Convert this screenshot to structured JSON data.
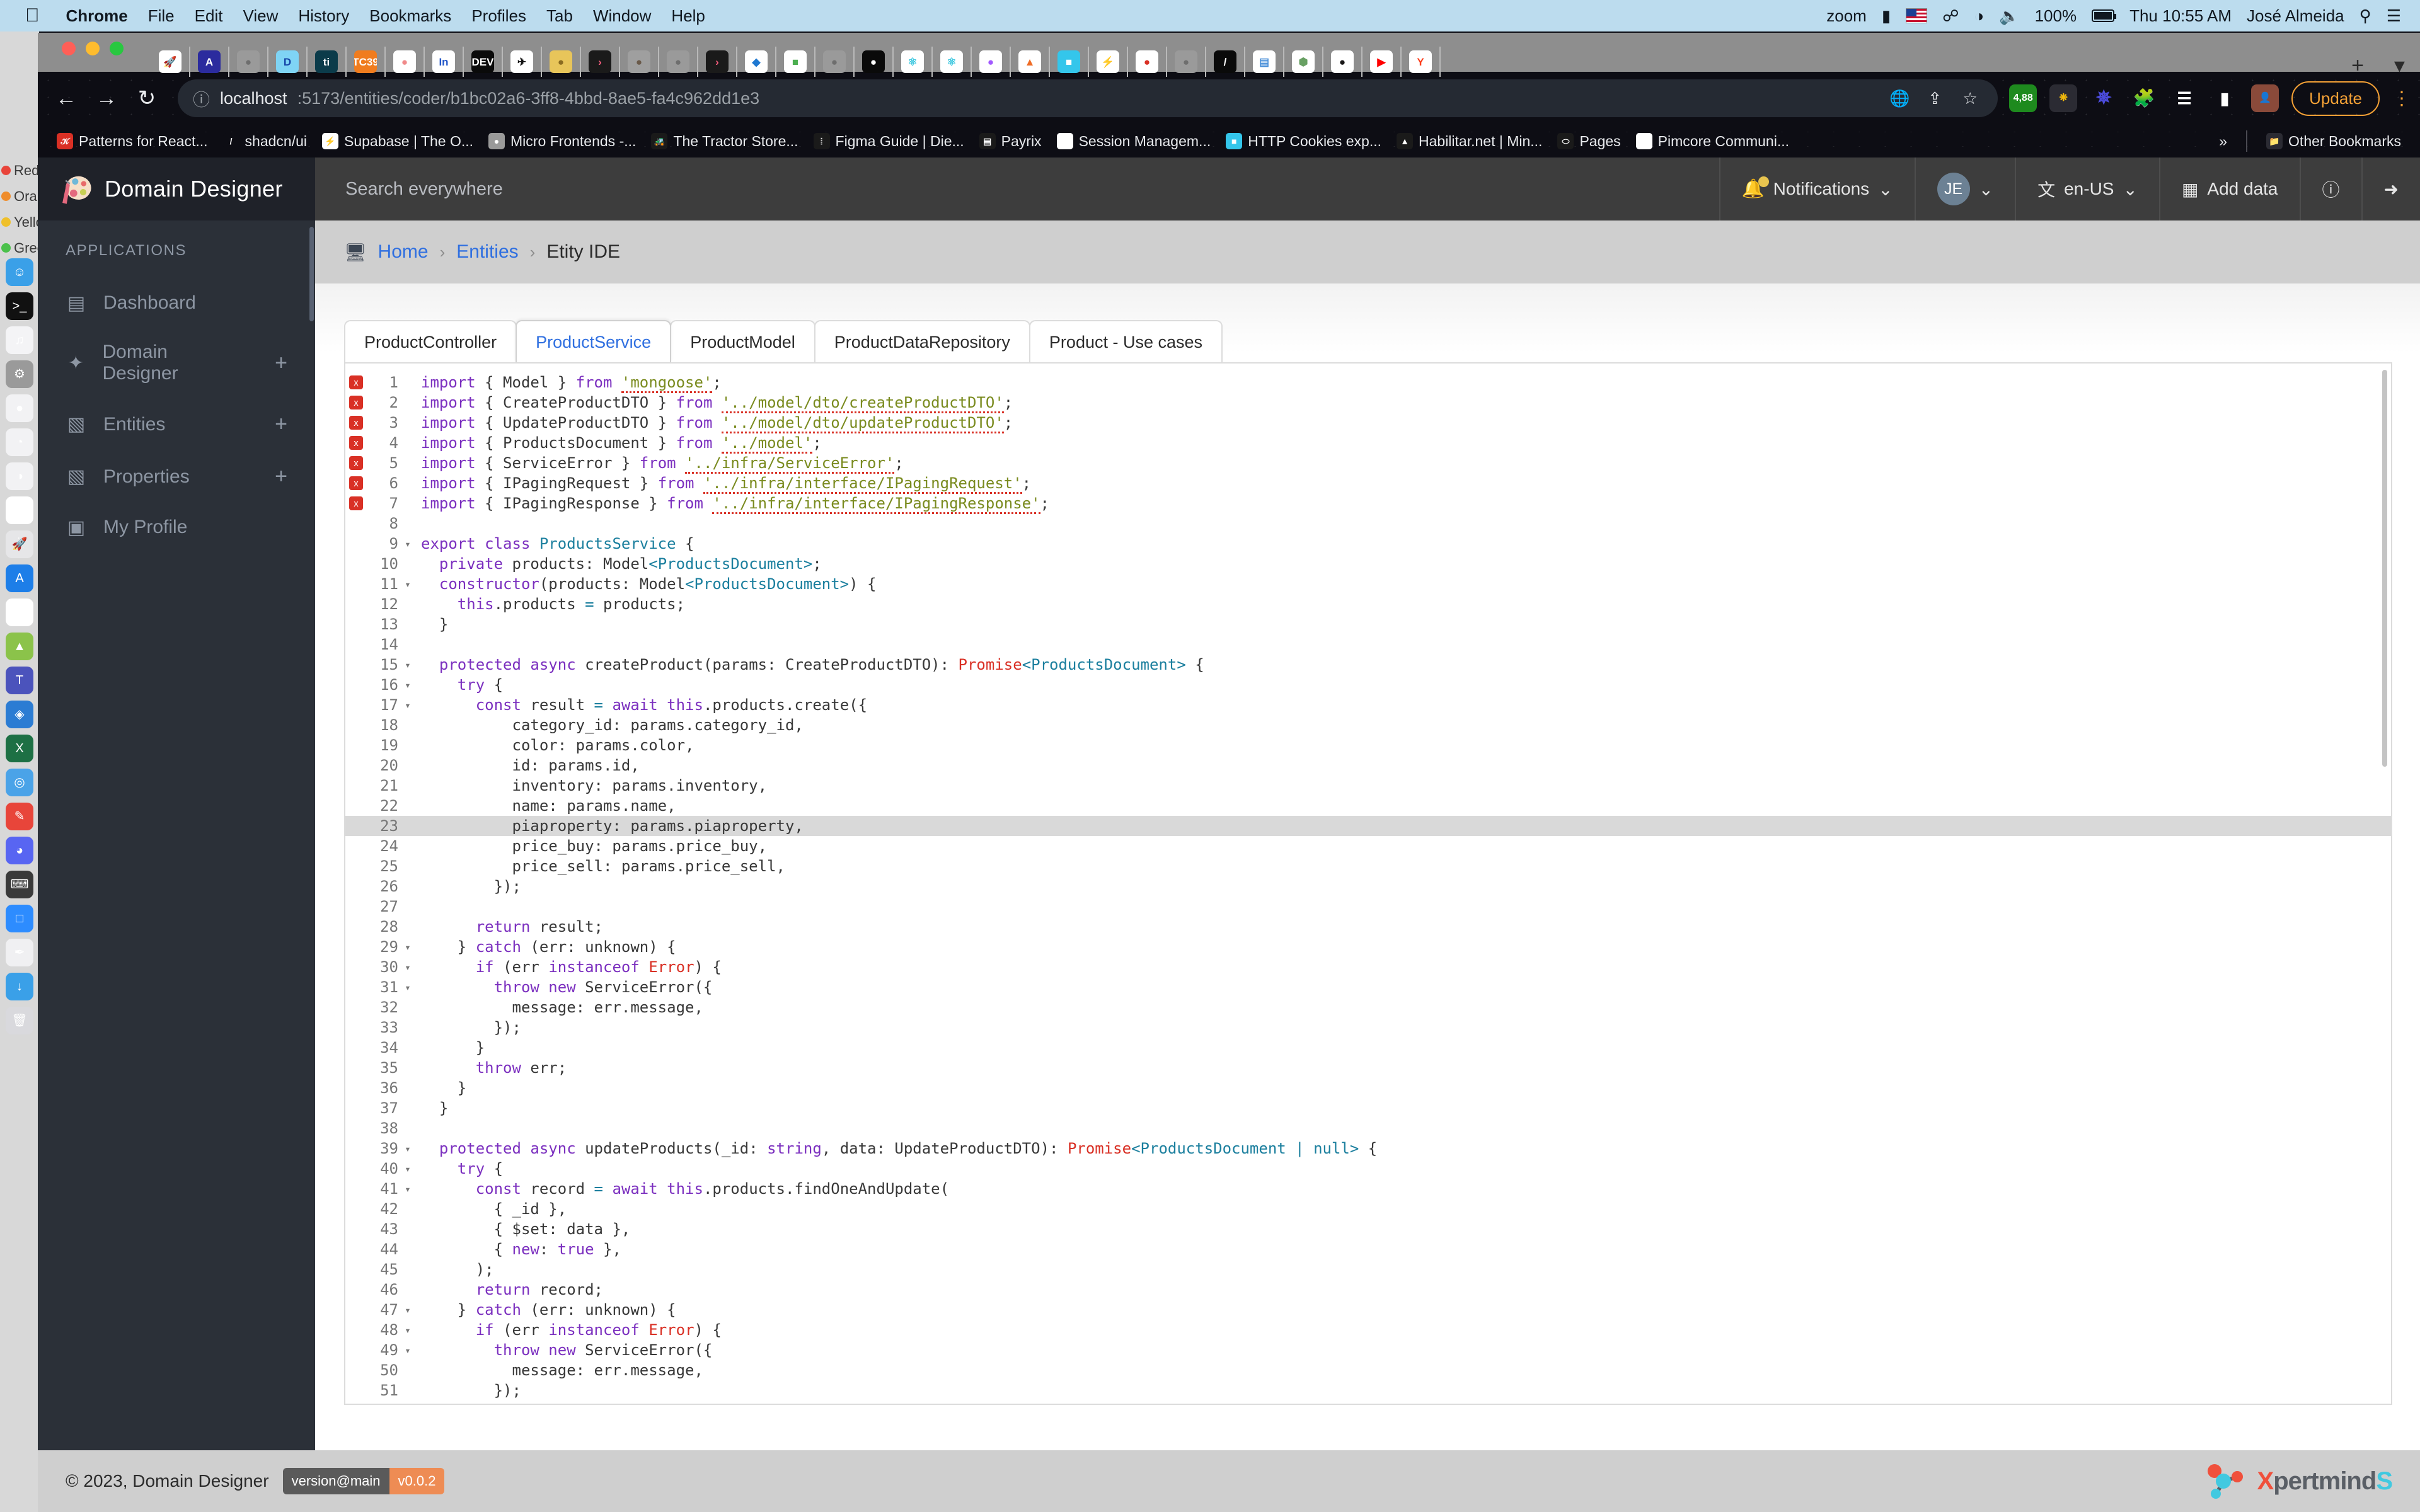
{
  "mac_menubar": {
    "apple": "",
    "items": [
      "Chrome",
      "File",
      "Edit",
      "View",
      "History",
      "Bookmarks",
      "Profiles",
      "Tab",
      "Window",
      "Help"
    ],
    "right": {
      "zoom": "zoom",
      "battery_percent": "100%",
      "clock": "Thu 10:55 AM",
      "user": "José Almeida"
    }
  },
  "browser": {
    "url_host": "localhost",
    "url_path": ":5173/entities/coder/b1bc02a6-3ff8-4bbd-8ae5-fa4c962dd1e3",
    "update_label": "Update",
    "extension_badge": "4,88",
    "tab_icons": [
      {
        "name": "rocket-tab-icon",
        "glyph": "🚀",
        "bg": "#ffffff",
        "color": "#ef8b32"
      },
      {
        "name": "algolia-tab-icon",
        "glyph": "A",
        "bg": "#2b2b9e",
        "color": "#ffffff"
      },
      {
        "name": "globe-tab-icon",
        "glyph": "●",
        "bg": "#9a9a9a",
        "color": "#6e6e6e"
      },
      {
        "name": "deno-tab-icon",
        "glyph": "D",
        "bg": "#7fd4f5",
        "color": "#1645a8"
      },
      {
        "name": "ti-tab-icon",
        "glyph": "ti",
        "bg": "#0b3b4a",
        "color": "#ffffff"
      },
      {
        "name": "tc39-tab-icon",
        "glyph": "TC39",
        "bg": "#f07c1e",
        "color": "#ffffff"
      },
      {
        "name": "nexus-tab-icon",
        "glyph": "●",
        "bg": "#ffffff",
        "color": "#f08a8a"
      },
      {
        "name": "insquad-tab-icon",
        "glyph": "In",
        "bg": "#ffffff",
        "color": "#2256c8"
      },
      {
        "name": "dev-tab-icon",
        "glyph": "DEV",
        "bg": "#0a0a0a",
        "color": "#ffffff"
      },
      {
        "name": "session-tab-icon",
        "glyph": "✈",
        "bg": "#ffffff",
        "color": "#111111"
      },
      {
        "name": "avatar-tab-icon",
        "glyph": "●",
        "bg": "#e8c55a",
        "color": "#8a6b20"
      },
      {
        "name": "chevron-tab-icon",
        "glyph": "›",
        "bg": "#1a1a1a",
        "color": "#f05a7a"
      },
      {
        "name": "photo-tab-icon",
        "glyph": "●",
        "bg": "#9f9f9f",
        "color": "#6a5a4a"
      },
      {
        "name": "globe2-tab-icon",
        "glyph": "●",
        "bg": "#9a9a9a",
        "color": "#6e6e6e"
      },
      {
        "name": "chevron2-tab-icon",
        "glyph": "›",
        "bg": "#1a1a1a",
        "color": "#f05a7a"
      },
      {
        "name": "diamond-tab-icon",
        "glyph": "◆",
        "bg": "#ffffff",
        "color": "#1f78d1"
      },
      {
        "name": "pimcore-tab-icon",
        "glyph": "■",
        "bg": "#ffffff",
        "color": "#4caf50"
      },
      {
        "name": "globe3-tab-icon",
        "glyph": "●",
        "bg": "#9a9a9a",
        "color": "#6e6e6e"
      },
      {
        "name": "medium-tab-icon",
        "glyph": "●",
        "bg": "#0a0a0a",
        "color": "#ffffff"
      },
      {
        "name": "react-tab-icon",
        "glyph": "⚛",
        "bg": "#ffffff",
        "color": "#3ec8e0"
      },
      {
        "name": "react2-tab-icon",
        "glyph": "⚛",
        "bg": "#ffffff",
        "color": "#3ec8e0"
      },
      {
        "name": "figma-tab-icon",
        "glyph": "●",
        "bg": "#ffffff",
        "color": "#a259ff"
      },
      {
        "name": "habilitar-tab-icon",
        "glyph": "▲",
        "bg": "#ffffff",
        "color": "#ef6c26"
      },
      {
        "name": "cookie-tab-icon",
        "glyph": "■",
        "bg": "#34c6eb",
        "color": "#ffffff"
      },
      {
        "name": "supabase-tab-icon",
        "glyph": "⚡",
        "bg": "#ffffff",
        "color": "#3ecf8e"
      },
      {
        "name": "tractor-tab-icon",
        "glyph": "●",
        "bg": "#ffffff",
        "color": "#d93025"
      },
      {
        "name": "micro-tab-icon",
        "glyph": "●",
        "bg": "#9a9a9a",
        "color": "#6e6e6e"
      },
      {
        "name": "shadcn-tab-icon",
        "glyph": "/",
        "bg": "#0a0a0a",
        "color": "#ffffff"
      },
      {
        "name": "db-tab-icon",
        "glyph": "▤",
        "bg": "#ffffff",
        "color": "#4a90d9"
      },
      {
        "name": "node-tab-icon",
        "glyph": "⬢",
        "bg": "#ffffff",
        "color": "#68a063"
      },
      {
        "name": "github-tab-icon",
        "glyph": "●",
        "bg": "#ffffff",
        "color": "#181717"
      },
      {
        "name": "youtube-tab-icon",
        "glyph": "▶",
        "bg": "#ffffff",
        "color": "#ff0000"
      },
      {
        "name": "yandex-tab-icon",
        "glyph": "Y",
        "bg": "#ffffff",
        "color": "#fc3f1d"
      }
    ],
    "bookmarks": [
      {
        "label": "Patterns for React...",
        "icon_name": "patterns-bookmark-icon",
        "glyph": "𝒦",
        "bg": "#d93025"
      },
      {
        "label": "shadcn/ui",
        "icon_name": "shadcn-bookmark-icon",
        "glyph": "/",
        "bg": "#0d0d14"
      },
      {
        "label": "Supabase | The O...",
        "icon_name": "supabase-bookmark-icon",
        "glyph": "⚡",
        "bg": "#ffffff"
      },
      {
        "label": "Micro Frontends -...",
        "icon_name": "microfrontends-bookmark-icon",
        "glyph": "●",
        "bg": "#9a9a9a"
      },
      {
        "label": "The Tractor Store...",
        "icon_name": "tractor-bookmark-icon",
        "glyph": "🚜",
        "bg": "#1a1a1a"
      },
      {
        "label": "Figma Guide | Die...",
        "icon_name": "figma-bookmark-icon",
        "glyph": "⦙",
        "bg": "#1a1a1a"
      },
      {
        "label": "Payrix",
        "icon_name": "payrix-bookmark-icon",
        "glyph": "▤",
        "bg": "#1a1a1a"
      },
      {
        "label": "Session Managem...",
        "icon_name": "session-bookmark-icon",
        "glyph": "✈",
        "bg": "#ffffff"
      },
      {
        "label": "HTTP Cookies exp...",
        "icon_name": "cookies-bookmark-icon",
        "glyph": "■",
        "bg": "#34c6eb"
      },
      {
        "label": "Habilitar.net | Min...",
        "icon_name": "habilitar-bookmark-icon",
        "glyph": "▲",
        "bg": "#1a1a1a"
      },
      {
        "label": "Pages",
        "icon_name": "pages-bookmark-icon",
        "glyph": "⬭",
        "bg": "#1a1a1a"
      },
      {
        "label": "Pimcore Communi...",
        "icon_name": "pimcore-bookmark-icon",
        "glyph": "∞",
        "bg": "#ffffff"
      }
    ],
    "overflow_label": "»",
    "other_bookmarks_label": "Other Bookmarks"
  },
  "desktop": {
    "color_labels": [
      {
        "name": "Red",
        "color": "#e8443a"
      },
      {
        "name": "Oran",
        "color": "#ef8c2b"
      },
      {
        "name": "Yello",
        "color": "#efc02b"
      },
      {
        "name": "Gree",
        "color": "#4cc14c"
      }
    ],
    "dock": [
      {
        "name": "finder-dock-icon",
        "glyph": "☺",
        "bg": "#3aa0e8"
      },
      {
        "name": "terminal-dock-icon",
        "glyph": ">_",
        "bg": "#111111"
      },
      {
        "name": "music-dock-icon",
        "glyph": "♫",
        "bg": "#f4f4f6"
      },
      {
        "name": "settings-dock-icon",
        "glyph": "⚙",
        "bg": "#9a9a9a"
      },
      {
        "name": "chrome-dock-icon",
        "glyph": "●",
        "bg": "#f2f2f4"
      },
      {
        "name": "edge-dock-icon",
        "glyph": "◔",
        "bg": "#f2f2f4"
      },
      {
        "name": "browser-dock-icon",
        "glyph": "◑",
        "bg": "#f2f2f4"
      },
      {
        "name": "calendar-dock-icon",
        "glyph": "24",
        "bg": "#ffffff"
      },
      {
        "name": "launchpad-dock-icon",
        "glyph": "🚀",
        "bg": "#e6e6e8"
      },
      {
        "name": "appstore-dock-icon",
        "glyph": "A",
        "bg": "#1d7ee8"
      },
      {
        "name": "screentime-dock-icon",
        "glyph": "◴",
        "bg": "#ffffff"
      },
      {
        "name": "android-dock-icon",
        "glyph": "▲",
        "bg": "#8bc34a"
      },
      {
        "name": "teams-dock-icon",
        "glyph": "T",
        "bg": "#4b53bc"
      },
      {
        "name": "vscode-dock-icon",
        "glyph": "◈",
        "bg": "#2b7cd3"
      },
      {
        "name": "excel-dock-icon",
        "glyph": "X",
        "bg": "#1d7044"
      },
      {
        "name": "maps-dock-icon",
        "glyph": "◎",
        "bg": "#4aa3e8"
      },
      {
        "name": "pen-dock-icon",
        "glyph": "✎",
        "bg": "#e8453a"
      },
      {
        "name": "discord-dock-icon",
        "glyph": "◕",
        "bg": "#5865f2"
      },
      {
        "name": "keyboard-dock-icon",
        "glyph": "⌨",
        "bg": "#3a3a3a"
      },
      {
        "name": "zoom-dock-icon",
        "glyph": "□",
        "bg": "#2d8cff"
      },
      {
        "name": "draw-dock-icon",
        "glyph": "✒",
        "bg": "#f0f0f2"
      },
      {
        "name": "downloads-dock-icon",
        "glyph": "↓",
        "bg": "#3aa0e8"
      },
      {
        "name": "trash-dock-icon",
        "glyph": "🗑",
        "bg": "#d9d9dd"
      }
    ]
  },
  "app": {
    "brand_name": "Domain Designer",
    "search_placeholder": "Search everywhere",
    "header": {
      "notifications_label": "Notifications",
      "avatar_initials": "JE",
      "language_label": "en-US",
      "add_data_label": "Add data",
      "help_icon_name": "help-icon",
      "logout_icon_name": "logout-icon"
    },
    "sidebar": {
      "caption": "APPLICATIONS",
      "items": [
        {
          "label": "Dashboard",
          "icon": "dashboard-icon",
          "glyph": "▤",
          "has_plus": false
        },
        {
          "label": "Domain Designer",
          "icon": "magic-wand-icon",
          "glyph": "✦",
          "has_plus": true
        },
        {
          "label": "Entities",
          "icon": "entities-icon",
          "glyph": "▧",
          "has_plus": true
        },
        {
          "label": "Properties",
          "icon": "properties-icon",
          "glyph": "▧",
          "has_plus": true
        },
        {
          "label": "My Profile",
          "icon": "profile-card-icon",
          "glyph": "▣",
          "has_plus": false
        }
      ]
    },
    "breadcrumb": {
      "icon": "monitor-icon",
      "home": "Home",
      "entities": "Entities",
      "current": "Etity IDE",
      "sep": "›"
    },
    "editor_tabs": [
      {
        "label": "ProductController",
        "active": false
      },
      {
        "label": "ProductService",
        "active": true
      },
      {
        "label": "ProductModel",
        "active": false
      },
      {
        "label": "ProductDataRepository",
        "active": false
      },
      {
        "label": "Product - Use cases",
        "active": false
      }
    ],
    "footer": {
      "copyright": "© 2023, Domain Designer",
      "version_left": "version@main",
      "version_right": "v0.0.2",
      "vendor": "XpertmindS"
    }
  },
  "code": {
    "language": "typescript",
    "error_marker": "x",
    "highlighted_line": 23,
    "lines": [
      {
        "n": 1,
        "err": true,
        "fold": "",
        "html": "<span class='kw'>import</span> { Model } <span class='kw'>from</span> <span class='str'>'mongoose'</span>;"
      },
      {
        "n": 2,
        "err": true,
        "fold": "",
        "html": "<span class='kw'>import</span> { CreateProductDTO } <span class='kw'>from</span> <span class='str'>'../model/dto/createProductDTO'</span>;"
      },
      {
        "n": 3,
        "err": true,
        "fold": "",
        "html": "<span class='kw'>import</span> { UpdateProductDTO } <span class='kw'>from</span> <span class='str'>'../model/dto/updateProductDTO'</span>;"
      },
      {
        "n": 4,
        "err": true,
        "fold": "",
        "html": "<span class='kw'>import</span> { ProductsDocument } <span class='kw'>from</span> <span class='str'>'../model'</span>;"
      },
      {
        "n": 5,
        "err": true,
        "fold": "",
        "html": "<span class='kw'>import</span> { ServiceError } <span class='kw'>from</span> <span class='str'>'../infra/ServiceError'</span>;"
      },
      {
        "n": 6,
        "err": true,
        "fold": "",
        "html": "<span class='kw'>import</span> { IPagingRequest } <span class='kw'>from</span> <span class='str'>'../infra/interface/IPagingRequest'</span>;"
      },
      {
        "n": 7,
        "err": true,
        "fold": "",
        "html": "<span class='kw'>import</span> { IPagingResponse } <span class='kw'>from</span> <span class='str'>'../infra/interface/IPagingResponse'</span>;"
      },
      {
        "n": 8,
        "err": false,
        "fold": "",
        "html": ""
      },
      {
        "n": 9,
        "err": false,
        "fold": "▾",
        "html": "<span class='kw'>export class</span> <span class='typ'>ProductsService</span> {"
      },
      {
        "n": 10,
        "err": false,
        "fold": "",
        "html": "  <span class='kw'>private</span> products: Model<span class='op'>&lt;ProductsDocument&gt;</span>;"
      },
      {
        "n": 11,
        "err": false,
        "fold": "▾",
        "html": "  <span class='kw'>constructor</span>(products: Model<span class='op'>&lt;ProductsDocument&gt;</span>) {"
      },
      {
        "n": 12,
        "err": false,
        "fold": "",
        "html": "    <span class='kw'>this</span>.products <span class='op'>=</span> products;"
      },
      {
        "n": 13,
        "err": false,
        "fold": "",
        "html": "  }"
      },
      {
        "n": 14,
        "err": false,
        "fold": "",
        "html": ""
      },
      {
        "n": 15,
        "err": false,
        "fold": "▾",
        "html": "  <span class='kw'>protected async</span> createProduct(params: CreateProductDTO): <span class='err'>Promise</span><span class='op'>&lt;ProductsDocument&gt;</span> {"
      },
      {
        "n": 16,
        "err": false,
        "fold": "▾",
        "html": "    <span class='kw'>try</span> {"
      },
      {
        "n": 17,
        "err": false,
        "fold": "▾",
        "html": "      <span class='kw'>const</span> result <span class='op'>=</span> <span class='kw'>await</span> <span class='kw'>this</span>.products.create({"
      },
      {
        "n": 18,
        "err": false,
        "fold": "",
        "html": "          category_id: params.category_id,"
      },
      {
        "n": 19,
        "err": false,
        "fold": "",
        "html": "          color: params.color,"
      },
      {
        "n": 20,
        "err": false,
        "fold": "",
        "html": "          id: params.id,"
      },
      {
        "n": 21,
        "err": false,
        "fold": "",
        "html": "          inventory: params.inventory,"
      },
      {
        "n": 22,
        "err": false,
        "fold": "",
        "html": "          name: params.name,"
      },
      {
        "n": 23,
        "err": false,
        "fold": "",
        "html": "          piaproperty: params.piaproperty,"
      },
      {
        "n": 24,
        "err": false,
        "fold": "",
        "html": "          price_buy: params.price_buy,"
      },
      {
        "n": 25,
        "err": false,
        "fold": "",
        "html": "          price_sell: params.price_sell,"
      },
      {
        "n": 26,
        "err": false,
        "fold": "",
        "html": "        });"
      },
      {
        "n": 27,
        "err": false,
        "fold": "",
        "html": ""
      },
      {
        "n": 28,
        "err": false,
        "fold": "",
        "html": "      <span class='kw'>return</span> result;"
      },
      {
        "n": 29,
        "err": false,
        "fold": "▾",
        "html": "    } <span class='kw'>catch</span> (err: unknown) {"
      },
      {
        "n": 30,
        "err": false,
        "fold": "▾",
        "html": "      <span class='kw'>if</span> (err <span class='kw'>instanceof</span> <span class='err'>Error</span>) {"
      },
      {
        "n": 31,
        "err": false,
        "fold": "▾",
        "html": "        <span class='kw'>throw new</span> ServiceError({"
      },
      {
        "n": 32,
        "err": false,
        "fold": "",
        "html": "          message: err.message,"
      },
      {
        "n": 33,
        "err": false,
        "fold": "",
        "html": "        });"
      },
      {
        "n": 34,
        "err": false,
        "fold": "",
        "html": "      }"
      },
      {
        "n": 35,
        "err": false,
        "fold": "",
        "html": "      <span class='kw'>throw</span> err;"
      },
      {
        "n": 36,
        "err": false,
        "fold": "",
        "html": "    }"
      },
      {
        "n": 37,
        "err": false,
        "fold": "",
        "html": "  }"
      },
      {
        "n": 38,
        "err": false,
        "fold": "",
        "html": ""
      },
      {
        "n": 39,
        "err": false,
        "fold": "▾",
        "html": "  <span class='kw'>protected async</span> updateProducts(_id: <span class='kw'>string</span>, data: UpdateProductDTO): <span class='err'>Promise</span><span class='op'>&lt;ProductsDocument | null&gt;</span> {"
      },
      {
        "n": 40,
        "err": false,
        "fold": "▾",
        "html": "    <span class='kw'>try</span> {"
      },
      {
        "n": 41,
        "err": false,
        "fold": "▾",
        "html": "      <span class='kw'>const</span> record <span class='op'>=</span> <span class='kw'>await</span> <span class='kw'>this</span>.products.findOneAndUpdate("
      },
      {
        "n": 42,
        "err": false,
        "fold": "",
        "html": "        { _id },"
      },
      {
        "n": 43,
        "err": false,
        "fold": "",
        "html": "        { $set: data },"
      },
      {
        "n": 44,
        "err": false,
        "fold": "",
        "html": "        { <span class='kw'>new</span>: <span class='kw'>true</span> },"
      },
      {
        "n": 45,
        "err": false,
        "fold": "",
        "html": "      );"
      },
      {
        "n": 46,
        "err": false,
        "fold": "",
        "html": "      <span class='kw'>return</span> record;"
      },
      {
        "n": 47,
        "err": false,
        "fold": "▾",
        "html": "    } <span class='kw'>catch</span> (err: unknown) {"
      },
      {
        "n": 48,
        "err": false,
        "fold": "▾",
        "html": "      <span class='kw'>if</span> (err <span class='kw'>instanceof</span> <span class='err'>Error</span>) {"
      },
      {
        "n": 49,
        "err": false,
        "fold": "▾",
        "html": "        <span class='kw'>throw new</span> ServiceError({"
      },
      {
        "n": 50,
        "err": false,
        "fold": "",
        "html": "          message: err.message,"
      },
      {
        "n": 51,
        "err": false,
        "fold": "",
        "html": "        });"
      }
    ]
  }
}
